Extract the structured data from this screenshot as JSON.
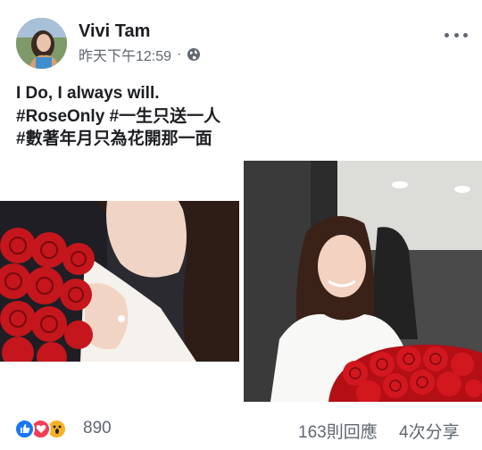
{
  "post": {
    "author_name": "Vivi Tam",
    "timestamp": "昨天下午12:59",
    "separator": "·",
    "privacy_icon": "globe-icon",
    "text_lines": [
      "I Do, I always will.",
      "#RoseOnly #一生只送一人",
      "#數著年月只為花開那一面"
    ]
  },
  "photos": [
    {
      "name": "photo-woman-smelling-roses",
      "description_icon": "photo"
    },
    {
      "name": "photo-woman-holding-rose-bouquet",
      "description_icon": "photo"
    }
  ],
  "reactions": {
    "icons": [
      "like-icon",
      "love-icon",
      "wow-icon"
    ],
    "count": "890",
    "comments": "163則回應",
    "shares": "4次分享"
  },
  "colors": {
    "like": "#1877f2",
    "love": "#f33e58",
    "wow": "#f7b125",
    "meta_text": "#606770",
    "rose_red": "#c4161c"
  }
}
